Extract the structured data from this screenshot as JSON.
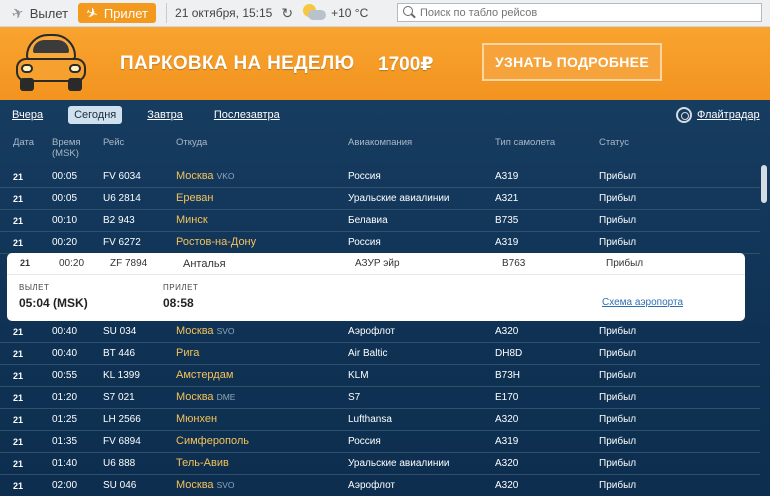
{
  "topbar": {
    "tab_departure": "Вылет",
    "tab_arrival": "Прилет",
    "active_tab": "arrival",
    "datetime": "21 октября, 15:15",
    "refresh_icon": "refresh-icon",
    "weather_icon": "partly-cloudy-icon",
    "temperature": "+10 °C",
    "search_placeholder": "Поиск по табло рейсов"
  },
  "banner": {
    "text": "ПАРКОВКА НА НЕДЕЛЮ",
    "price": "1700₽",
    "button": "УЗНАТЬ ПОДРОБНЕЕ",
    "accent_color": "#f39a1e"
  },
  "days": [
    "Вчера",
    "Сегодня",
    "Завтра",
    "Послезавтра"
  ],
  "active_day": "Сегодня",
  "flightradar_link": "Флайтрадар",
  "columns": {
    "date": "Дата",
    "time": "Время",
    "time_sub": "(MSK)",
    "flight": "Рейс",
    "from": "Откуда",
    "airline": "Авиакомпания",
    "type": "Тип самолета",
    "status": "Статус"
  },
  "rows_top": [
    {
      "date": "21",
      "time": "00:05",
      "flight": "FV 6034",
      "city": "Москва",
      "code": "VKO",
      "airline": "Россия",
      "type": "A319",
      "status": "Прибыл"
    },
    {
      "date": "21",
      "time": "00:05",
      "flight": "U6 2814",
      "city": "Ереван",
      "code": "",
      "airline": "Уральские авиалинии",
      "type": "A321",
      "status": "Прибыл"
    },
    {
      "date": "21",
      "time": "00:10",
      "flight": "B2 943",
      "city": "Минск",
      "code": "",
      "airline": "Белавиа",
      "type": "B735",
      "status": "Прибыл"
    },
    {
      "date": "21",
      "time": "00:20",
      "flight": "FV 6272",
      "city": "Ростов-на-Дону",
      "code": "",
      "airline": "Россия",
      "type": "A319",
      "status": "Прибыл"
    }
  ],
  "expanded": {
    "date": "21",
    "time": "00:20",
    "flight": "ZF 7894",
    "city": "Анталья",
    "airline": "АЗУР эйр",
    "type": "B763",
    "status": "Прибыл",
    "departure_label": "ВЫЛЕТ",
    "departure_value": "05:04 (MSK)",
    "arrival_label": "ПРИЛЕТ",
    "arrival_value": "08:58",
    "scheme_link": "Схема аэропорта"
  },
  "rows_bottom": [
    {
      "date": "21",
      "time": "00:40",
      "flight": "SU 034",
      "city": "Москва",
      "code": "SVO",
      "airline": "Аэрофлот",
      "type": "A320",
      "status": "Прибыл"
    },
    {
      "date": "21",
      "time": "00:40",
      "flight": "BT 446",
      "city": "Рига",
      "code": "",
      "airline": "Air Baltic",
      "type": "DH8D",
      "status": "Прибыл"
    },
    {
      "date": "21",
      "time": "00:55",
      "flight": "KL 1399",
      "city": "Амстердам",
      "code": "",
      "airline": "KLM",
      "type": "B73H",
      "status": "Прибыл"
    },
    {
      "date": "21",
      "time": "01:20",
      "flight": "S7 021",
      "city": "Москва",
      "code": "DME",
      "airline": "S7",
      "type": "E170",
      "status": "Прибыл"
    },
    {
      "date": "21",
      "time": "01:25",
      "flight": "LH 2566",
      "city": "Мюнхен",
      "code": "",
      "airline": "Lufthansa",
      "type": "A320",
      "status": "Прибыл"
    },
    {
      "date": "21",
      "time": "01:35",
      "flight": "FV 6894",
      "city": "Симферополь",
      "code": "",
      "airline": "Россия",
      "type": "A319",
      "status": "Прибыл"
    },
    {
      "date": "21",
      "time": "01:40",
      "flight": "U6 888",
      "city": "Тель-Авив",
      "code": "",
      "airline": "Уральские авиалинии",
      "type": "A320",
      "status": "Прибыл"
    },
    {
      "date": "21",
      "time": "02:00",
      "flight": "SU 046",
      "city": "Москва",
      "code": "SVO",
      "airline": "Аэрофлот",
      "type": "A320",
      "status": "Прибыл"
    }
  ]
}
